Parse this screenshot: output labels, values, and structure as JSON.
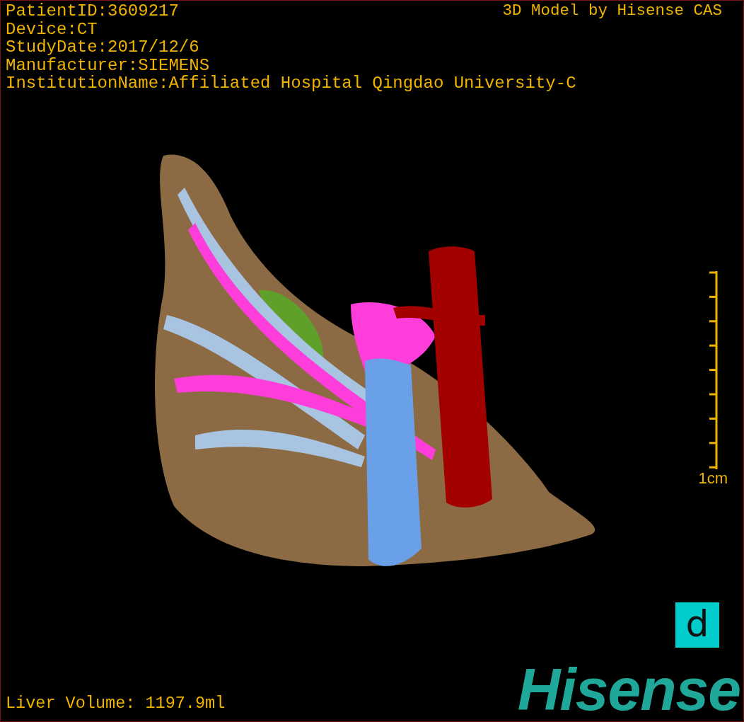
{
  "header": {
    "info_lines": [
      "PatientID:3609217",
      "Device:CT",
      "StudyDate:2017/12/6",
      "Manufacturer:SIEMENS",
      "InstitutionName:Affiliated Hospital Qingdao University-C"
    ],
    "credit": "3D Model by Hisense CAS"
  },
  "viewport": {
    "scale_bar": {
      "label": "1cm"
    }
  },
  "footer": {
    "liver_volume": "Liver Volume: 1197.9ml",
    "orientation_marker": {
      "label": "d"
    },
    "logo": "Hisense"
  }
}
